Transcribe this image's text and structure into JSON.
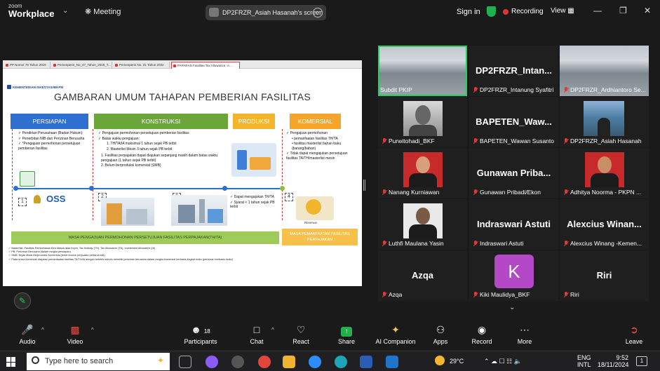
{
  "app": {
    "brand_small": "zoom",
    "brand_big": "Workplace",
    "meeting_label": "Meeting",
    "share_title": "DP2FRZR_Asiah Hasanah's screen",
    "sign_in": "Sign in",
    "recording": "Recording",
    "view": "View"
  },
  "slide": {
    "tabs": [
      "PP Nomor 78 Tahun 2019",
      "Pemenperin_No_47_Tahun_2019_T...",
      "Pemenperin No. 31 Tahun 2022",
      "PAPARAN Fasilitas Tax Allowance -A..."
    ],
    "logo": "KEMENTERIAN INVESTASI/BKPM",
    "title": "GAMBARAN UMUM TAHAPAN PEMBERIAN FASILITAS",
    "phases": [
      "PERSIAPAN",
      "KONSTRUKSI",
      "PRODUKSI",
      "KOMERSIAL"
    ],
    "persiapan": [
      "Pendirian Perusahaan (Badan Hukum)",
      "Penerbitan NIB dan Perizinan Berusaha",
      "*Pengajuan permohonan persetujuan pemberian fasilitas"
    ],
    "konstruksi": [
      "Pengajuan permohonan persetujuan pemberian fasilitas",
      "Batas waktu pengajuan:",
      "1. TH/TA/IA maksimal 1 tahun sejak PB terbit",
      "2. Masterlist Mesin 3 tahun sejak PB terbit",
      "1. Fasilitas perpajakan dapat diajukan sepanjang masih dalam batas waktu pengajuan (1 tahun sejak PB terbit)",
      "2. Belum berproduksi komersial (SMB)"
    ],
    "produksi": [
      "Dapat mengajukan TH/TA",
      "Syarat < 1 tahun sejak PB terbit"
    ],
    "komersial": [
      "Pengajuan permohonan",
      "pemanfaatan fasilitas TH/TA",
      "fasilitas masterlist bahan baku (barang/bahan)",
      "Tidak dapat mengajukan persetujuan fasilitas TA/TH/masterlist mesin"
    ],
    "numbers": [
      "1",
      "2",
      "3",
      "4"
    ],
    "oss": "OSS",
    "revenue": "Revenue",
    "band_left": "MASA PENGAJUAN PERMOHONAN PERSETUJUAN FASILITAS PERPAJAKAN(TH/TA)",
    "band_right": "MASA PEMANFAATAN FASILITAS PERPAJAKAN",
    "footnotes": [
      "Masterlist: Fasilitas Pembebasan Bea Masuk atas Impor, Tax Holiday (TH), Tax Allowance (TA), Investment Allowance (IA)",
      "PB: Perizinan Berusaha (dalam rangka persiapan)",
      "SMB: Sejak Mulai Berproduksi Komersial (terbit invoice penjualan pertama kali)",
      "Pada masa komersial diajukan pemanfaatan fasilitas TA/TH/IA dengan terlebih dahulu memiliki perizinan berusaha dalam rangka komersial berbasis tingkat risiko (perizinan berbasis risiko)"
    ]
  },
  "participants": [
    {
      "big": "",
      "caption": "Subdit PKIP",
      "muted": false
    },
    {
      "big": "DP2FRZR_Intan...",
      "caption": "DP2FRZR_Intanung Syafitri",
      "muted": true
    },
    {
      "big": "",
      "caption": "DP2FRZR_Ardhiantoro Se...",
      "muted": true
    },
    {
      "big": "",
      "caption": "Purwitohadi_BKF",
      "muted": true
    },
    {
      "big": "BAPETEN_Waw...",
      "caption": "BAPETEN_Wawan Susanto",
      "muted": true
    },
    {
      "big": "",
      "caption": "DP2FRZR_Asiah Hasanah",
      "muted": true
    },
    {
      "big": "",
      "caption": "Nanang Kurniawan",
      "muted": true
    },
    {
      "big": "Gunawan Priba...",
      "caption": "Gunawan Pribadi/Ekon",
      "muted": true
    },
    {
      "big": "",
      "caption": "Adhitya Noorma - PKPN ...",
      "muted": true
    },
    {
      "big": "",
      "caption": "Luthfi Maulana Yasin",
      "muted": true
    },
    {
      "big": "Indraswari Astuti",
      "caption": "Indraswari Astuti",
      "muted": true
    },
    {
      "big": "Alexcius Winan...",
      "caption": "Alexcius Winang -Kemen...",
      "muted": true
    },
    {
      "big": "Azqa",
      "caption": "Azqa",
      "muted": true
    },
    {
      "big": "K",
      "caption": "Kiki Maulidya_BKF",
      "muted": true
    },
    {
      "big": "Riri",
      "caption": "Riri",
      "muted": true
    }
  ],
  "toolbar": [
    {
      "label": "Audio",
      "icon": "mic-muted-icon"
    },
    {
      "label": "Video",
      "icon": "video-off-icon"
    },
    {
      "label": "Participants",
      "icon": "participants-icon",
      "count": "18"
    },
    {
      "label": "Chat",
      "icon": "chat-icon"
    },
    {
      "label": "React",
      "icon": "heart-icon"
    },
    {
      "label": "Share",
      "icon": "share-icon"
    },
    {
      "label": "AI Companion",
      "icon": "sparkle-icon"
    },
    {
      "label": "Apps",
      "icon": "apps-icon"
    },
    {
      "label": "Record",
      "icon": "record-icon"
    },
    {
      "label": "More",
      "icon": "more-icon"
    },
    {
      "label": "Leave",
      "icon": "leave-icon"
    }
  ],
  "taskbar": {
    "search_placeholder": "Type here to search",
    "temp": "29°C",
    "lang1": "ENG",
    "lang2": "INTL",
    "time": "9:52",
    "date": "18/11/2024",
    "notif": "1"
  }
}
